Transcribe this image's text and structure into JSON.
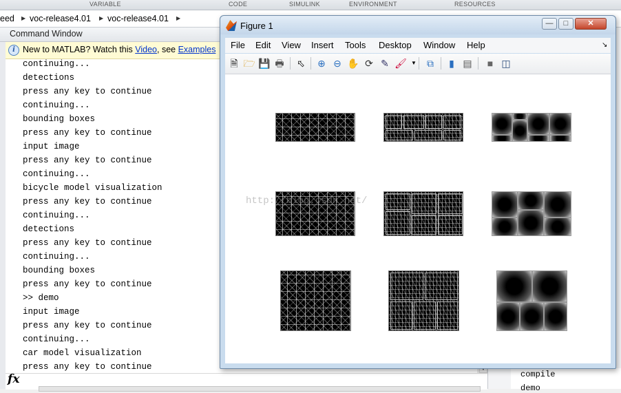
{
  "ribbon": {
    "tabs": [
      "VARIABLE",
      "CODE",
      "SIMULINK",
      "ENVIRONMENT",
      "RESOURCES"
    ]
  },
  "address_bar": {
    "crumbs": [
      "eed",
      "voc-release4.01",
      "voc-release4.01"
    ]
  },
  "command_window": {
    "title": "Command Window",
    "info": {
      "text_before": "New to MATLAB? Watch this ",
      "video_link": "Video",
      "text_middle": ", see ",
      "examples_link": "Examples"
    },
    "lines": [
      "continuing...",
      "detections",
      "press any key to continue",
      "continuing...",
      "bounding boxes",
      "press any key to continue",
      "input image",
      "press any key to continue",
      "continuing...",
      "bicycle model visualization",
      "press any key to continue",
      "continuing...",
      "detections",
      "press any key to continue",
      "continuing...",
      "bounding boxes",
      "press any key to continue",
      ">> demo",
      "input image",
      "press any key to continue",
      "continuing...",
      "car model visualization",
      "press any key to continue"
    ],
    "prompt_symbol": "fx"
  },
  "file_tree": {
    "items": [
      "compile",
      "demo"
    ]
  },
  "figure": {
    "title": "Figure 1",
    "menu": [
      "File",
      "Edit",
      "View",
      "Insert",
      "Tools",
      "Desktop",
      "Window",
      "Help"
    ],
    "toolbar_icons": [
      "new-figure-icon",
      "open-icon",
      "save-icon",
      "print-icon",
      "pointer-icon",
      "zoom-in-icon",
      "zoom-out-icon",
      "pan-icon",
      "rotate-icon",
      "data-cursor-icon",
      "brush-icon",
      "link-plot-icon",
      "colorbar-icon",
      "legend-icon",
      "hide-plot-tools-icon",
      "show-plot-tools-icon"
    ],
    "watermark": "http://blog.csdn.net/"
  },
  "colors": {
    "link": "#0033cc",
    "figure_frame": "#c9dcee",
    "info_bar": "#fffbd4"
  }
}
